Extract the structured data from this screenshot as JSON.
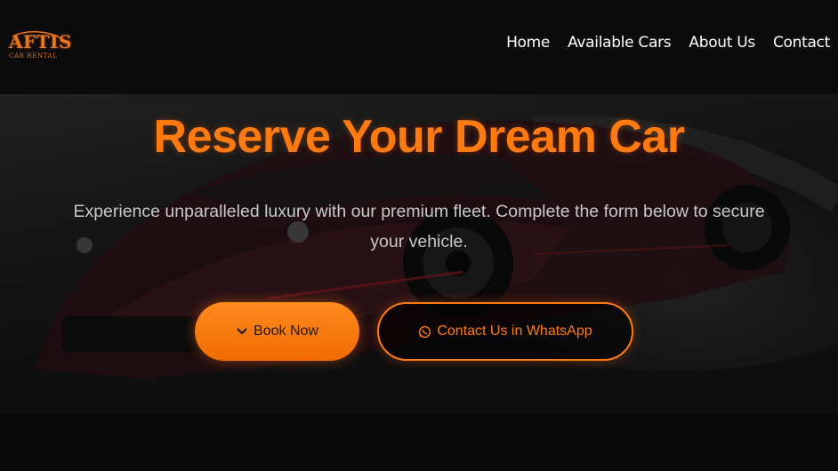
{
  "brand": {
    "logo_title": "AFTIS",
    "logo_subtitle": "CAR RENTAL",
    "accent_color": "#ff7b12"
  },
  "nav": {
    "items": [
      {
        "label": "Home"
      },
      {
        "label": "Available Cars"
      },
      {
        "label": "About Us"
      },
      {
        "label": "Contact"
      }
    ]
  },
  "hero": {
    "title": "Reserve Your Dream Car",
    "subtitle": "Experience unparalleled luxury with our premium fleet. Complete the form below to secure your vehicle.",
    "background_image": "dark red supercar on race track",
    "primary_button": {
      "label": "Book Now",
      "icon": "chevron-down-icon"
    },
    "secondary_button": {
      "label": "Contact Us in WhatsApp",
      "icon": "whatsapp-icon"
    }
  }
}
